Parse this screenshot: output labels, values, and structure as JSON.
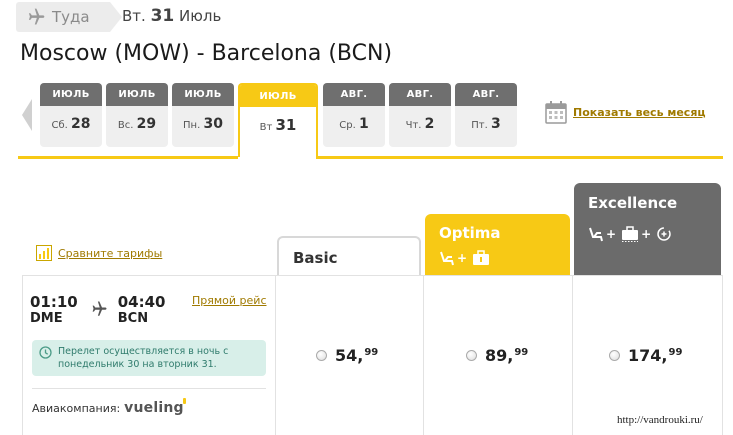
{
  "direction": {
    "label": "Туда",
    "weekday": "Вт.",
    "day": "31",
    "month": "Июль"
  },
  "route_title": "Moscow (MOW) - Barcelona (BCN)",
  "dates": [
    {
      "month": "ИЮЛЬ",
      "weekday": "Сб.",
      "day": "28"
    },
    {
      "month": "ИЮЛЬ",
      "weekday": "Вс.",
      "day": "29"
    },
    {
      "month": "ИЮЛЬ",
      "weekday": "Пн.",
      "day": "30"
    },
    {
      "month": "ИЮЛЬ",
      "weekday": "Вт",
      "day": "31"
    },
    {
      "month": "АВГ.",
      "weekday": "Ср.",
      "day": "1"
    },
    {
      "month": "АВГ.",
      "weekday": "Чт.",
      "day": "2"
    },
    {
      "month": "АВГ.",
      "weekday": "Пт.",
      "day": "3"
    }
  ],
  "show_month_link": "Показать весь месяц",
  "compare_link": "Сравните тарифы",
  "fares": {
    "basic": {
      "name": "Basic",
      "price_int": "54,",
      "price_dec": "99"
    },
    "optima": {
      "name": "Optima",
      "price_int": "89,",
      "price_dec": "99"
    },
    "excellence": {
      "name": "Excellence",
      "price_int": "174,",
      "price_dec": "99"
    }
  },
  "flight": {
    "dep_time": "01:10",
    "dep_airport": "DME",
    "arr_time": "04:40",
    "arr_airport": "BCN",
    "direct_label": "Прямой рейс",
    "note": "Перелет осуществляется в ночь с понедельник 30 на вторник 31.",
    "airline_label": "Авиакомпания:",
    "airline_name": "vueling"
  },
  "watermark": "http://vandrouki.ru/",
  "colors": {
    "accent": "#f7c915",
    "dark": "#6b6b6b",
    "note_bg": "#d8efe9"
  }
}
